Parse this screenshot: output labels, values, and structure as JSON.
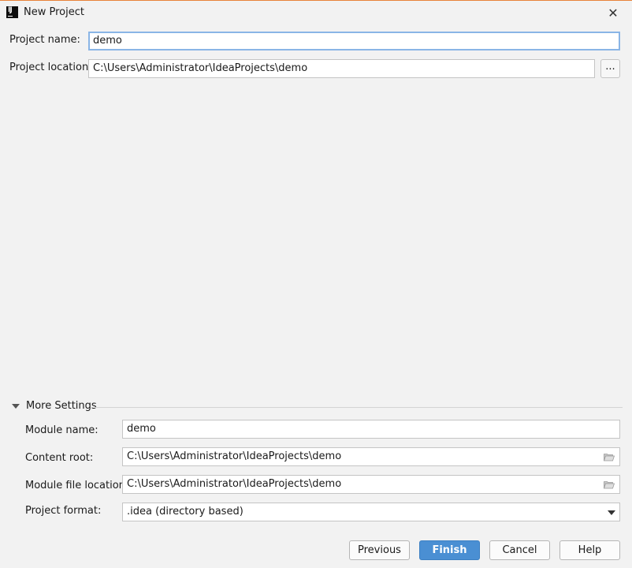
{
  "window": {
    "title": "New Project"
  },
  "project_name": {
    "label": "Project name:",
    "value": "demo"
  },
  "project_location": {
    "label": "Project location:",
    "value": "C:\\Users\\Administrator\\IdeaProjects\\demo",
    "browse_label": "..."
  },
  "more_settings": {
    "title": "More Settings",
    "expanded": true,
    "module_name": {
      "label": "Module name:",
      "value": "demo"
    },
    "content_root": {
      "label": "Content root:",
      "value": "C:\\Users\\Administrator\\IdeaProjects\\demo"
    },
    "module_file_location": {
      "label": "Module file location:",
      "value": "C:\\Users\\Administrator\\IdeaProjects\\demo"
    },
    "project_format": {
      "label": "Project format:",
      "value": ".idea (directory based)"
    }
  },
  "buttons": {
    "previous": "Previous",
    "finish": "Finish",
    "cancel": "Cancel",
    "help": "Help"
  },
  "icons": {
    "app": "intellij-logo-icon",
    "close": "close-icon",
    "folder": "folder-icon",
    "collapse": "triangle-down-icon",
    "dropdown": "chevron-down-icon"
  },
  "colors": {
    "accent_top": "#e8823a",
    "primary_button": "#4a8fd3",
    "focus_border": "#8ab5e6",
    "background": "#f2f2f2"
  }
}
